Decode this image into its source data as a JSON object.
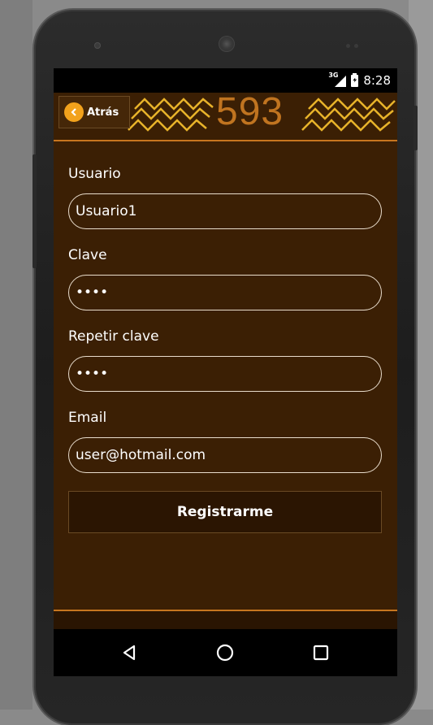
{
  "status_bar": {
    "network_label": "3G",
    "time": "8:28",
    "icons": [
      "signal-icon",
      "battery-charging-icon"
    ]
  },
  "header": {
    "back_label": "Atrás",
    "brand": "593",
    "accent_color": "#f2a21c",
    "zigzag_color": "#e8b32a"
  },
  "form": {
    "fields": [
      {
        "label": "Usuario",
        "value": "Usuario1"
      },
      {
        "label": "Clave",
        "value": "••••"
      },
      {
        "label": "Repetir clave",
        "value": "••••"
      },
      {
        "label": "Email",
        "value": "user@hotmail.com"
      }
    ],
    "submit_label": "Registrarme"
  },
  "nav_bar": {
    "icons": [
      "back-triangle-icon",
      "home-circle-icon",
      "recents-square-icon"
    ]
  },
  "colors": {
    "background": "#3b1f04",
    "border": "#c7761f"
  }
}
